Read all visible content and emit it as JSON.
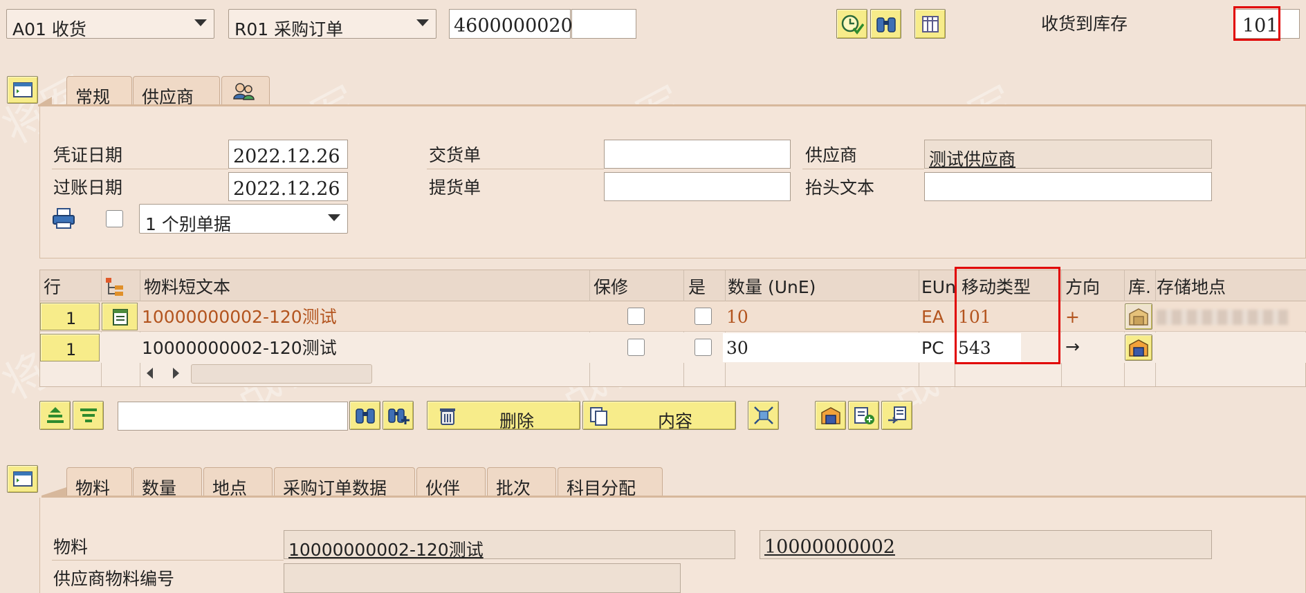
{
  "header": {
    "transaction_select": "A01 收货",
    "ref_doc_select": "R01 采购订单",
    "po_number": "4600000020",
    "po_item": "",
    "movement_label": "收货到库存",
    "movement_type": "101"
  },
  "header_tabs": [
    {
      "label": "常规"
    },
    {
      "label": "供应商"
    }
  ],
  "general": {
    "doc_date_label": "凭证日期",
    "doc_date": "2022.12.26",
    "post_date_label": "过账日期",
    "post_date": "2022.12.26",
    "delivery_note_label": "交货单",
    "delivery_note": "",
    "bill_of_lading_label": "提货单",
    "bill_of_lading": "",
    "vendor_label": "供应商",
    "vendor": "测试供应商",
    "header_text_label": "抬头文本",
    "header_text": "",
    "print_option": "1 个别单据"
  },
  "grid": {
    "columns": [
      "行",
      "物料短文本",
      "保修",
      "是",
      "数量 (UnE)",
      "EUn",
      "移动类型",
      "方向",
      "库.",
      "存储地点"
    ],
    "rows": [
      {
        "line": "1",
        "material": "10000000002-120测试",
        "qty": "10",
        "unit": "EA",
        "mvt": "101",
        "dir": "+"
      },
      {
        "line": "1",
        "material": "10000000002-120测试",
        "qty": "30",
        "unit": "PC",
        "mvt": "543",
        "dir": "→"
      }
    ]
  },
  "toolbar2": {
    "search_value": "",
    "delete_label": "删除",
    "contents_label": "内容"
  },
  "detail_tabs": [
    {
      "label": "物料"
    },
    {
      "label": "数量"
    },
    {
      "label": "地点"
    },
    {
      "label": "采购订单数据"
    },
    {
      "label": "伙伴"
    },
    {
      "label": "批次"
    },
    {
      "label": "科目分配"
    }
  ],
  "detail": {
    "material_label": "物料",
    "material_text": "10000000002-120测试",
    "material_number": "10000000002",
    "vendor_mat_label": "供应商物料编号",
    "vendor_mat": ""
  },
  "colors": {
    "background": "#f2e3d7",
    "button_yellow": "#f7ec8a",
    "highlight_red": "#e10000",
    "item_text_brown": "#b3541e"
  }
}
